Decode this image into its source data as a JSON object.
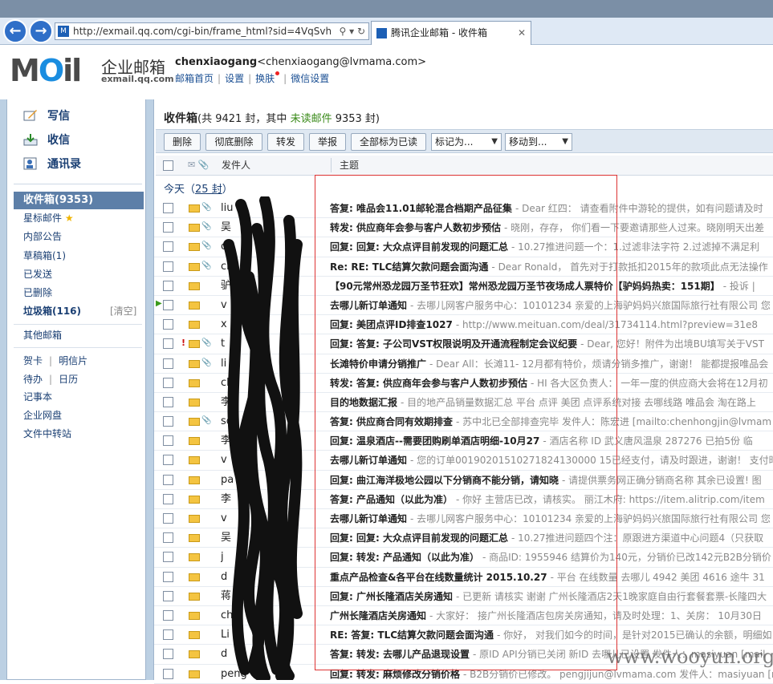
{
  "browser": {
    "url": "http://exmail.qq.com/cgi-bin/frame_html?sid=4VqSvh",
    "tab_title": "腾讯企业邮箱 - 收件箱"
  },
  "header": {
    "logo": "MOil",
    "product_name": "企业邮箱",
    "product_domain": "exmail.qq.com",
    "username": "chenxiaogang",
    "email": "<chenxiaogang@lvmama.com>",
    "links": [
      "邮箱首页",
      "设置",
      "换肤",
      "微信设置"
    ]
  },
  "sidebar": {
    "compose": "写信",
    "receive": "收信",
    "contacts": "通讯录",
    "inbox": "收件箱(9353)",
    "folders": [
      "星标邮件",
      "内部公告",
      "草稿箱(1)",
      "已发送",
      "已删除"
    ],
    "spam": "垃圾箱(116)",
    "spam_clear": "[清空]",
    "other": "其他邮箱",
    "tools": [
      [
        "贺卡",
        "明信片"
      ],
      [
        "待办",
        "日历"
      ]
    ],
    "tools2": [
      "记事本",
      "企业网盘",
      "文件中转站"
    ]
  },
  "main": {
    "title": "收件箱",
    "count_prefix": "(共 9421 封，其中",
    "unread_label": "未读邮件",
    "count_suffix": "9353 封)",
    "buttons": [
      "删除",
      "彻底删除",
      "转发",
      "举报",
      "全部标为已读"
    ],
    "mark_as": "标记为...",
    "move_to": "移动到...",
    "col_sender": "发件人",
    "col_subject": "主题",
    "today": "今天",
    "today_count": "25 封"
  },
  "emails": [
    {
      "sender": "liu",
      "subject": "答复: 唯品会11.01邮轮混合档期产品征集",
      "preview": "- Dear 红四：  请查看附件中游轮的提供，如有问题请及时"
    },
    {
      "sender": "吴",
      "subject": "转发: 供应商年会参与客户人数初步预估",
      "preview": "- 晓刚，存存， 你们看一下要邀请那些人过来。晓刚明天出差"
    },
    {
      "sender": "ca",
      "subject": "回复: 回复: 大众点评目前发现的问题汇总",
      "preview": "- 10.27推进问题一个：1.过滤非法字符 2.过滤掉不满足利"
    },
    {
      "sender": "ch",
      "subject": "Re: RE: TLC结算欠款问题会面沟通",
      "preview": "- Dear Ronald， 首先对于打款抵扣2015年的款项此点无法操作"
    },
    {
      "sender": "驴",
      "subject": "【90元常州恐龙园万圣节狂欢】常州恐龙园万圣节夜场成人票特价【驴妈妈热卖：151期】",
      "preview": "- 投诉 |"
    },
    {
      "sender": "v",
      "subject": "去哪儿新订单通知",
      "preview": "- 去哪儿网客户服务中心：10101234 亲爱的上海驴妈妈兴旅国际旅行社有限公司 您"
    },
    {
      "sender": "x",
      "subject": "回复: 美团点评ID排查1027",
      "preview": "- http://www.meituan.com/deal/31734114.html?preview=31e8"
    },
    {
      "sender": "t",
      "subject": "回复: 答复: 子公司VST权限说明及开通流程制定会议纪要",
      "preview": "- Dear, 您好！附件为出境BU填写关于VST"
    },
    {
      "sender": "li",
      "subject": "长滩特价申请分销推广",
      "preview": "- Dear All：长滩11- 12月都有特价，烦请分销多推广，谢谢！ 能都提报唯品会"
    },
    {
      "sender": "ch",
      "subject": "转发: 答复: 供应商年会参与客户人数初步预估",
      "preview": "- HI 各大区负责人： 一年一度的供应商大会将在12月初"
    },
    {
      "sender": "李",
      "subject": "目的地数据汇报",
      "preview": "- 目的地产品销量数据汇总   平台 点评 美团 点评系统对接 去哪线路 唯品会 淘在路上"
    },
    {
      "sender": "so",
      "subject": "答复: 供应商合同有效期排查",
      "preview": "- 苏中北已全部排查完毕 发件人：陈宏进 [mailto:chenhongjin@lvmam"
    },
    {
      "sender": "李",
      "subject": "回复: 温泉酒店--需要团购刷单酒店明细-10月27",
      "preview": "- 酒店名称 ID   武义唐风温泉 287276 已拍5份 临"
    },
    {
      "sender": "v",
      "subject": "去哪儿新订单通知",
      "preview": "- 您的订单00190201510271824130000 15已经支付，请及时跟进，谢谢！ 支付时"
    },
    {
      "sender": "pa",
      "subject": "回复: 曲江海洋极地公园以下分销商不能分销，请知晓",
      "preview": "- 请提供票务网正确分销商名称 其余已设置! 图"
    },
    {
      "sender": "李",
      "subject": "答复: 产品通知（以此为准）",
      "preview": "- 你好 主营店已改，请核实。 丽江木府: https://item.alitrip.com/item"
    },
    {
      "sender": "v",
      "subject": "去哪儿新订单通知",
      "preview": "- 去哪儿网客户服务中心：10101234 亲爱的上海驴妈妈兴旅国际旅行社有限公司 您"
    },
    {
      "sender": "吴",
      "subject": "回复: 回复: 大众点评目前发现的问题汇总",
      "preview": "- 10.27推进问题四个注：原跟进方渠道中心问题4（只获取"
    },
    {
      "sender": "j",
      "subject": "回复: 转发: 产品通知（以此为准）",
      "preview": "- 商品ID: 1955946 结算价为140元，分销价已改142元B2B分销价"
    },
    {
      "sender": "d",
      "subject": "重点产品检查&各平台在线数量统计 2015.10.27",
      "preview": "- 平台 在线数量 去哪儿 4942 美团 4616 途牛 31"
    },
    {
      "sender": "蒋",
      "subject": "回复: 广州长隆酒店关房通知",
      "preview": "- 已更新 请核实 谢谢 广州长隆酒店2天1晚家庭自由行套餐套票-长隆四大"
    },
    {
      "sender": "ch",
      "subject": "广州长隆酒店关房通知",
      "preview": "- 大家好：  接广州长隆酒店包房关房通知，请及时处理：1、关房： 10月30日"
    },
    {
      "sender": "Li",
      "subject": "RE: 答复: TLC结算欠款问题会面沟通",
      "preview": "- 你好， 对我们如今的时间，是针对2015已确认的余额，明细如"
    },
    {
      "sender": "d",
      "subject": "答复: 转发: 去哪儿产品退现设置",
      "preview": "- 原ID API分销已关闭 新ID 去哪儿已设置 发件人：masiyuan [mail"
    },
    {
      "sender": "peng",
      "subject": "回复: 转发: 麻烦修改分销价格",
      "preview": "- B2B分销价已修改。 pengjijun@lvmama.com 发件人：masiyuan [m"
    }
  ],
  "watermark": "www.wooyun.org"
}
